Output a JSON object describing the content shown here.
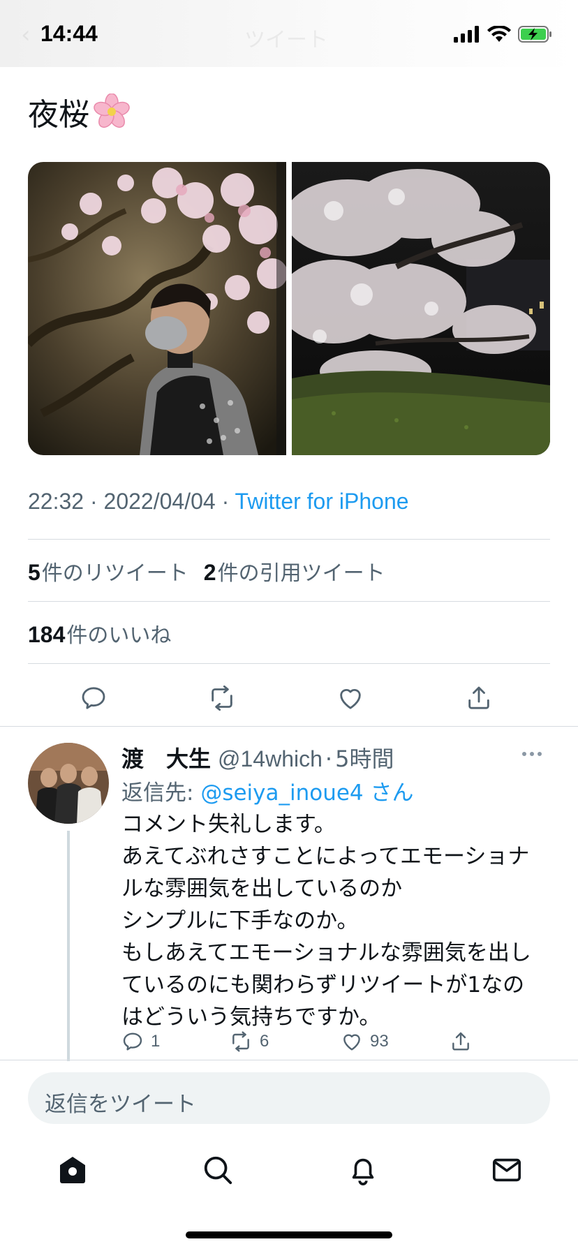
{
  "status_bar": {
    "time": "14:44",
    "faded_title": "ツイート",
    "icons": [
      "cellular-signal-icon",
      "wifi-icon",
      "battery-charging-icon"
    ]
  },
  "tweet": {
    "text": "夜桜",
    "emoji": "cherry-blossom-icon",
    "images": [
      "man-under-cherry-blossoms-photo",
      "night-cherry-blossom-tree-photo"
    ],
    "timestamp": "22:32 · 2022/04/04 · ",
    "source": "Twitter for iPhone",
    "retweet_count": "5",
    "retweet_label": "件のリツイート",
    "quote_count": "2",
    "quote_label": "件の引用ツイート",
    "like_count": "184",
    "like_label": "件のいいね",
    "actions": [
      "reply-icon",
      "retweet-icon",
      "like-icon",
      "share-icon"
    ]
  },
  "reply": {
    "name": "渡　大生",
    "handle": "@14which",
    "dot": "·",
    "time": "5時間",
    "reply_prefix": "返信先: ",
    "reply_mention": "@seiya_inoue4 さん",
    "body_lines": [
      "コメント失礼します。",
      "あえてぶれさすことによってエモーショナ",
      "ルな雰囲気を出しているのか",
      "シンプルに下手なのか。",
      "もしあえてエモーショナルな雰囲気を出し",
      "ているのにも関わらずリツイートが1なの",
      "はどういう気持ちですか。"
    ],
    "reply_count": "1",
    "retweet_count": "6",
    "like_count": "93"
  },
  "compose": {
    "placeholder": "返信をツイート"
  },
  "bottom_nav": [
    "home-icon",
    "search-icon",
    "notifications-icon",
    "messages-icon"
  ],
  "colors": {
    "accent": "#1d9bf0",
    "secondary_text": "#536471",
    "primary_text": "#0f1419",
    "divider": "#d6dbe0",
    "compose_bg": "#eff3f4"
  }
}
